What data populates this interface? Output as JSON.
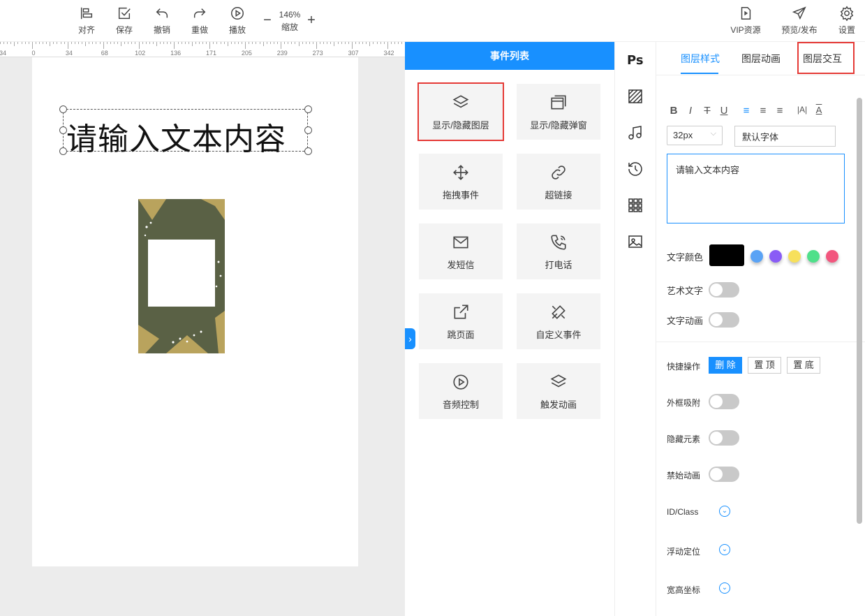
{
  "toolbar": {
    "align": "对齐",
    "save": "保存",
    "undo": "撤销",
    "redo": "重做",
    "play": "播放",
    "zoom_value": "146%",
    "zoom_label": "缩放",
    "zoom_minus": "−",
    "zoom_plus": "+",
    "vip": "VIP资源",
    "preview": "预览/发布",
    "settings": "设置"
  },
  "ruler": {
    "labels": [
      "34",
      "0",
      "34",
      "68",
      "102",
      "136",
      "171",
      "205",
      "239",
      "273",
      "307",
      "342"
    ]
  },
  "canvas": {
    "text": "请输入文本内容"
  },
  "events": {
    "title": "事件列表",
    "items": [
      {
        "label": "显示/隐藏图层",
        "icon": "layers-icon"
      },
      {
        "label": "显示/隐藏弹窗",
        "icon": "windows-icon"
      },
      {
        "label": "拖拽事件",
        "icon": "move-icon"
      },
      {
        "label": "超链接",
        "icon": "link-icon"
      },
      {
        "label": "发短信",
        "icon": "mail-icon"
      },
      {
        "label": "打电话",
        "icon": "phone-icon"
      },
      {
        "label": "跳页面",
        "icon": "external-link-icon"
      },
      {
        "label": "自定义事件",
        "icon": "tools-icon"
      },
      {
        "label": "音频控制",
        "icon": "play-circle-icon"
      },
      {
        "label": "触发动画",
        "icon": "layers-icon"
      }
    ]
  },
  "iconstrip": {
    "ps": "Ps"
  },
  "props": {
    "tabs": [
      "图层样式",
      "图层动画",
      "图层交互"
    ],
    "font_size": "32px",
    "font_family": "默认字体",
    "text_value": "请输入文本内容",
    "text_color_label": "文字颜色",
    "text_color": "#000000",
    "palette": [
      "#5aa3f5",
      "#8a5cf6",
      "#f7e05b",
      "#4fe08a",
      "#f2567e"
    ],
    "art_text_label": "艺术文字",
    "text_anim_label": "文字动画",
    "quick_ops_label": "快捷操作",
    "delete_btn": "删 除",
    "top_btn": "置 顶",
    "bottom_btn": "置 底",
    "snap_label": "外框吸附",
    "hide_label": "隐藏元素",
    "no_anim_label": "禁始动画",
    "id_class_label": "ID/Class",
    "float_label": "浮动定位",
    "size_label": "宽高坐标"
  }
}
